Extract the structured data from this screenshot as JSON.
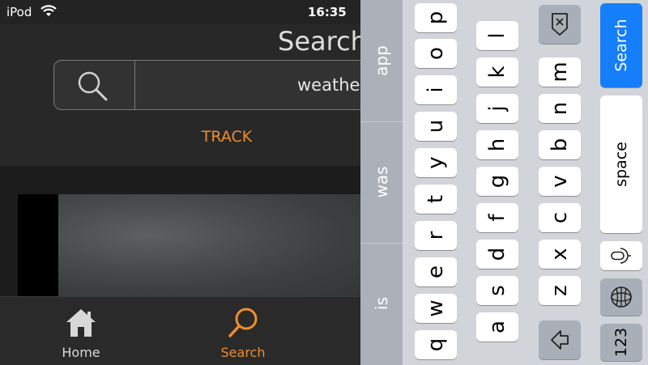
{
  "status_bar": {
    "carrier": "iPod",
    "time": "16:35",
    "wifi_icon": "wifi-icon"
  },
  "header": {
    "title": "Search"
  },
  "search": {
    "query": "weather",
    "icon": "search-icon"
  },
  "tabs": [
    {
      "label": "TRACK",
      "active": true
    }
  ],
  "tab_bar": {
    "items": [
      {
        "label": "Home",
        "icon": "home-icon",
        "active": false
      },
      {
        "label": "Search",
        "icon": "search-icon",
        "active": true
      }
    ]
  },
  "keyboard": {
    "suggestions": [
      "app",
      "was",
      "is"
    ],
    "row1": [
      "q",
      "w",
      "e",
      "r",
      "t",
      "y",
      "u",
      "i",
      "o",
      "p"
    ],
    "row2": [
      "a",
      "s",
      "d",
      "f",
      "g",
      "h",
      "j",
      "k",
      "l"
    ],
    "row3": [
      "z",
      "x",
      "c",
      "v",
      "b",
      "n",
      "m"
    ],
    "shift_icon": "shift-icon",
    "delete_icon": "delete-icon",
    "numbers_label": "123",
    "globe_icon": "globe-icon",
    "mic_icon": "microphone-icon",
    "space_label": "space",
    "search_label": "Search"
  },
  "colors": {
    "accent": "#ef8d2f",
    "keyboard_blue": "#147efb",
    "background": "#232323"
  }
}
